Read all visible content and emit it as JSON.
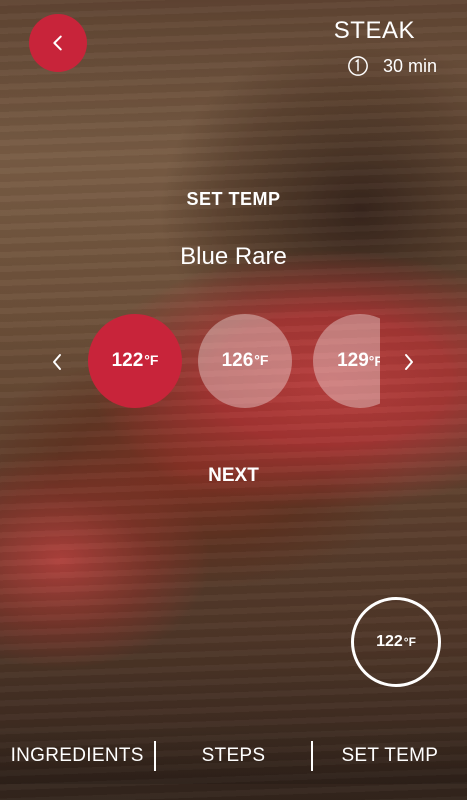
{
  "header": {
    "title": "STEAK",
    "time": "30 min",
    "back_icon": "chevron-left-icon",
    "clock_icon": "clock-icon",
    "accent_color": "#c8243a"
  },
  "temp_picker": {
    "heading": "SET TEMP",
    "doneness": "Blue Rare",
    "unit": "°F",
    "options": [
      {
        "value": "122",
        "selected": true
      },
      {
        "value": "126",
        "selected": false
      },
      {
        "value": "129",
        "selected": false
      }
    ],
    "next_label": "NEXT"
  },
  "current_temp": {
    "value": "122",
    "unit": "°F"
  },
  "bottom_nav": {
    "items": [
      "INGREDIENTS",
      "STEPS",
      "SET TEMP"
    ]
  }
}
